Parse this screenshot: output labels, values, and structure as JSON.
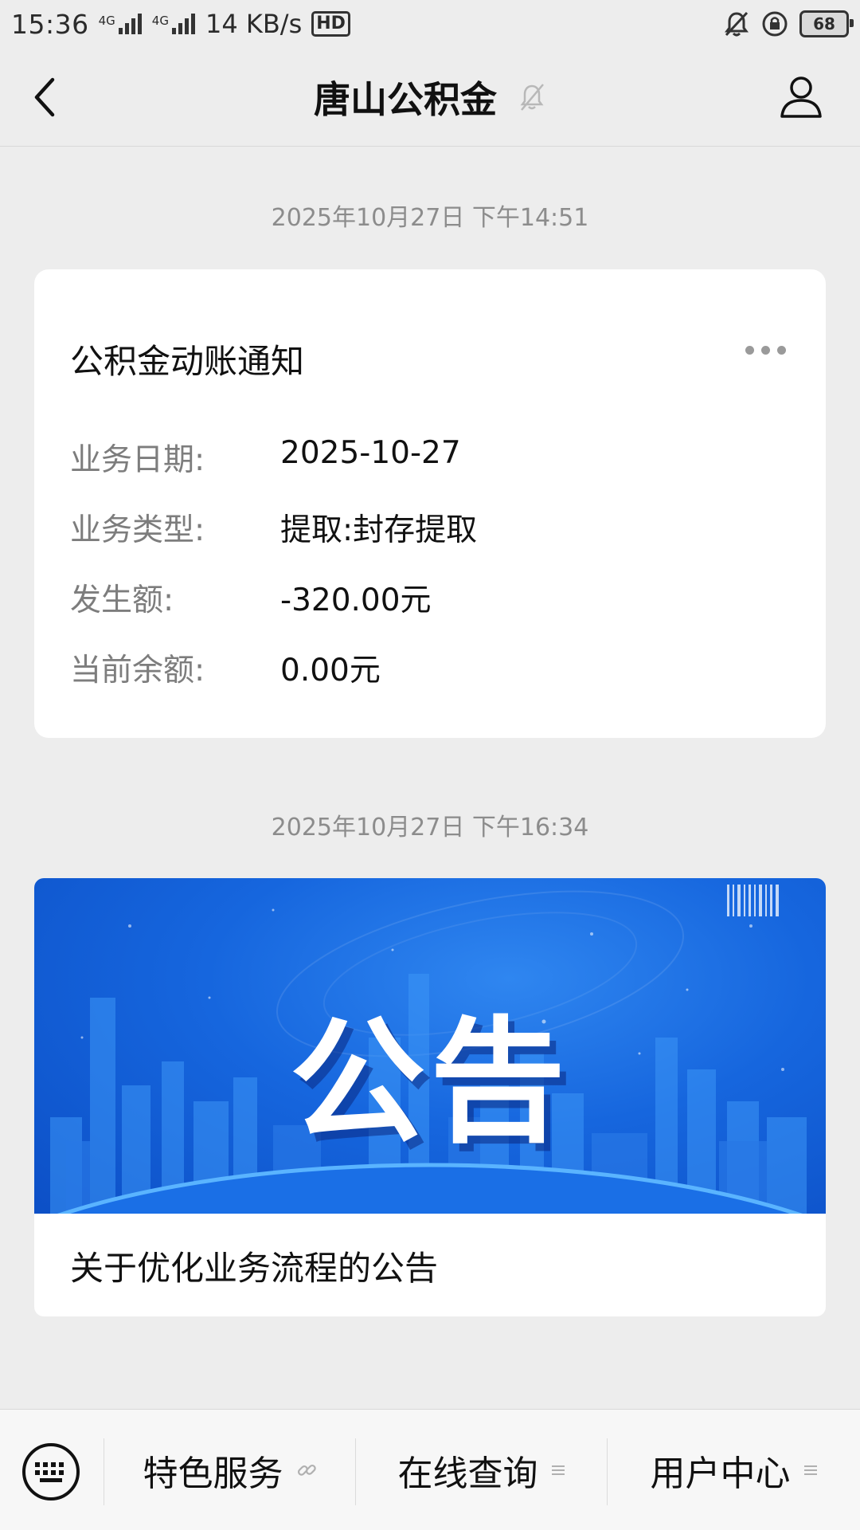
{
  "status_bar": {
    "time": "15:36",
    "network_1": "4G",
    "network_2": "4G",
    "speed": "14 KB/s",
    "hd_label": "HD",
    "battery": "68"
  },
  "header": {
    "title": "唐山公积金"
  },
  "messages": [
    {
      "timestamp": "2025年10月27日 下午14:51",
      "card_title": "公积金动账通知",
      "fields": [
        {
          "label": "业务日期:",
          "value": "2025-10-27"
        },
        {
          "label": "业务类型:",
          "value": "提取:封存提取"
        },
        {
          "label": "发生额:",
          "value": "-320.00元"
        },
        {
          "label": "当前余额:",
          "value": "0.00元"
        }
      ]
    },
    {
      "timestamp": "2025年10月27日 下午16:34",
      "banner_text": "公告",
      "article_title": "关于优化业务流程的公告"
    }
  ],
  "bottom_menu": {
    "items": [
      {
        "label": "特色服务",
        "icon": "link-icon"
      },
      {
        "label": "在线查询",
        "icon": "menu-lines-icon"
      },
      {
        "label": "用户中心",
        "icon": "menu-lines-icon"
      }
    ]
  },
  "colors": {
    "background": "#ededed",
    "card": "#ffffff",
    "banner_blue": "#1666de",
    "label_gray": "#7d7d7d"
  }
}
